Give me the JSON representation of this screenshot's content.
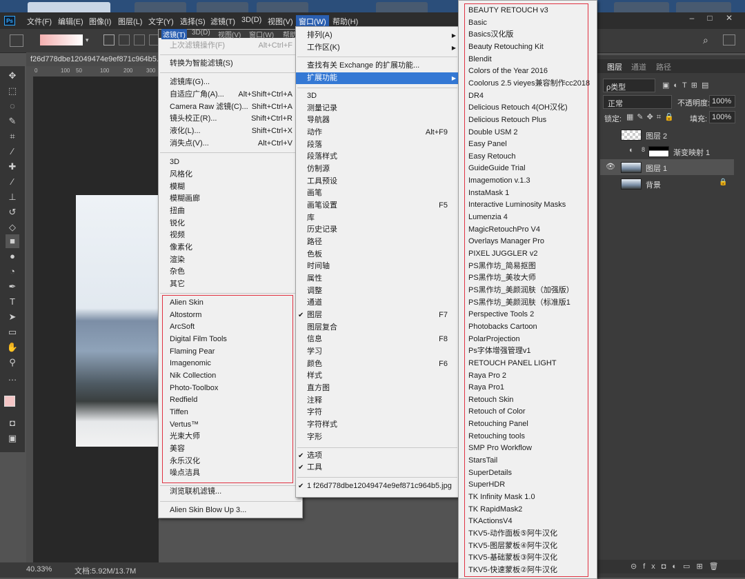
{
  "menubar": {
    "items": [
      "文件(F)",
      "编辑(E)",
      "图像(I)",
      "图层(L)",
      "文字(Y)",
      "选择(S)",
      "滤镜(T)",
      "3D(D)",
      "视图(V)",
      "窗口(W)",
      "帮助(H)"
    ],
    "active": "窗口(W)"
  },
  "document": {
    "tab_title": "f26d778dbe12049474e9ef871c964b5.j",
    "ruler_ticks": [
      "0",
      "100",
      "50",
      "100",
      "200",
      "300"
    ]
  },
  "status": {
    "zoom": "40.33%",
    "doc_info": "文档:5.92M/13.7M"
  },
  "filter_menu": {
    "header_tabs": [
      "滤镜(T)",
      "3D(D)",
      "视图(V)",
      "窗口(W)",
      "帮助"
    ],
    "items_top": [
      {
        "label": "上次滤镜操作(F)",
        "shortcut": "Alt+Ctrl+F",
        "disabled": true
      },
      {
        "label": "转换为智能滤镜(S)",
        "shortcut": ""
      },
      {
        "label": "滤镜库(G)...",
        "shortcut": ""
      },
      {
        "label": "自适应广角(A)...",
        "shortcut": "Alt+Shift+Ctrl+A"
      },
      {
        "label": "Camera Raw 滤镜(C)...",
        "shortcut": "Shift+Ctrl+A"
      },
      {
        "label": "镜头校正(R)...",
        "shortcut": "Shift+Ctrl+R"
      },
      {
        "label": "液化(L)...",
        "shortcut": "Shift+Ctrl+X"
      },
      {
        "label": "消失点(V)...",
        "shortcut": "Alt+Ctrl+V"
      }
    ],
    "categories": [
      "3D",
      "风格化",
      "模糊",
      "模糊画廊",
      "扭曲",
      "锐化",
      "视频",
      "像素化",
      "渲染",
      "杂色",
      "其它"
    ],
    "plugins": [
      "Alien Skin",
      "Altostorm",
      "ArcSoft",
      "Digital Film Tools",
      "Flaming Pear",
      "Imagenomic",
      "Nik Collection",
      "Photo-Toolbox",
      "Redfield",
      "Tiffen",
      "Vertus™",
      "光束大师",
      "美容",
      "永乐汉化",
      "噪点洁具"
    ],
    "browse": "浏览联机滤镜...",
    "last": "Alien Skin Blow Up 3..."
  },
  "window_menu": {
    "items_top": [
      {
        "label": "排列(A)",
        "submenu": true
      },
      {
        "label": "工作区(K)",
        "submenu": true
      },
      {
        "label": "查找有关 Exchange 的扩展功能...",
        "submenu": false
      },
      {
        "label": "扩展功能",
        "submenu": true,
        "highlighted": true
      }
    ],
    "panels": [
      {
        "label": "3D"
      },
      {
        "label": "测量记录"
      },
      {
        "label": "导航器"
      },
      {
        "label": "动作",
        "shortcut": "Alt+F9"
      },
      {
        "label": "段落"
      },
      {
        "label": "段落样式"
      },
      {
        "label": "仿制源"
      },
      {
        "label": "工具预设"
      },
      {
        "label": "画笔"
      },
      {
        "label": "画笔设置",
        "shortcut": "F5"
      },
      {
        "label": "库"
      },
      {
        "label": "历史记录"
      },
      {
        "label": "路径"
      },
      {
        "label": "色板"
      },
      {
        "label": "时间轴"
      },
      {
        "label": "属性"
      },
      {
        "label": "调整"
      },
      {
        "label": "通道"
      },
      {
        "label": "图层",
        "shortcut": "F7",
        "checked": true
      },
      {
        "label": "图层复合"
      },
      {
        "label": "信息",
        "shortcut": "F8"
      },
      {
        "label": "学习"
      },
      {
        "label": "颜色",
        "shortcut": "F6"
      },
      {
        "label": "样式"
      },
      {
        "label": "直方图"
      },
      {
        "label": "注释"
      },
      {
        "label": "字符"
      },
      {
        "label": "字符样式"
      },
      {
        "label": "字形"
      }
    ],
    "options": [
      {
        "label": "选项",
        "checked": true
      },
      {
        "label": "工具",
        "checked": true
      }
    ],
    "doc": "1 f26d778dbe12049474e9ef871c964b5.jpg"
  },
  "extensions_menu": {
    "items": [
      "BEAUTY RETOUCH v3",
      "Basic",
      "Basics汉化版",
      "Beauty Retouching Kit",
      "Blendit",
      "Colors of the Year 2016",
      "Coolorus 2.5 vieyes兼容制作cc2018",
      "DR4",
      "Delicious Retouch 4(OH汉化)",
      "Delicious Retouch Plus",
      "Double USM 2",
      "Easy Panel",
      "Easy Retouch",
      "GuideGuide Trial",
      "Imagemotion v.1.3",
      "InstaMask 1",
      "Interactive Luminosity Masks",
      "Lumenzia 4",
      "MagicRetouchPro V4",
      "Overlays Manager Pro",
      "PIXEL JUGGLER v2",
      "PS黑作坊_简易抠图",
      "PS黑作坊_美妆大师",
      "PS黑作坊_美颜润肤（加强版）",
      "PS黑作坊_美颜润肤（标准版1",
      "Perspective Tools 2",
      "Photobacks Cartoon",
      "PolarProjection",
      "Ps字体增强管理v1",
      "RETOUCH PANEL LIGHT",
      "Raya Pro 2",
      "Raya Pro1",
      "Retouch Skin",
      "Retouch of Color",
      "Retouching Panel",
      "Retouching tools",
      "SMP Pro Workflow",
      "StarsTail",
      "SuperDetails",
      "SuperHDR",
      "TK Infinity Mask 1.0",
      "TK RapidMask2",
      "TKActionsV4",
      "TKV5-动作面板⑤阿牛汉化",
      "TKV5-图层蒙板④阿牛汉化",
      "TKV5-基础蒙板③阿牛汉化",
      "TKV5-快速蒙板②阿牛汉化"
    ]
  },
  "layers_panel": {
    "tabs": [
      "图层",
      "通道",
      "路径"
    ],
    "filter_label": "ρ类型",
    "blend_mode": "正常",
    "opacity_label": "不透明度:",
    "opacity_value": "100%",
    "lock_label": "锁定:",
    "fill_label": "填充:",
    "fill_value": "100%",
    "layers": [
      {
        "name": "图层 2",
        "visible": false
      },
      {
        "name": "渐变映射 1",
        "visible": false
      },
      {
        "name": "图层 1",
        "visible": true,
        "selected": true
      },
      {
        "name": "背景",
        "visible": false,
        "locked": true
      }
    ]
  },
  "colors": {
    "highlight": "#3478d4",
    "red_outline": "#e03040",
    "fg_swatch": "#f4c6c6"
  }
}
